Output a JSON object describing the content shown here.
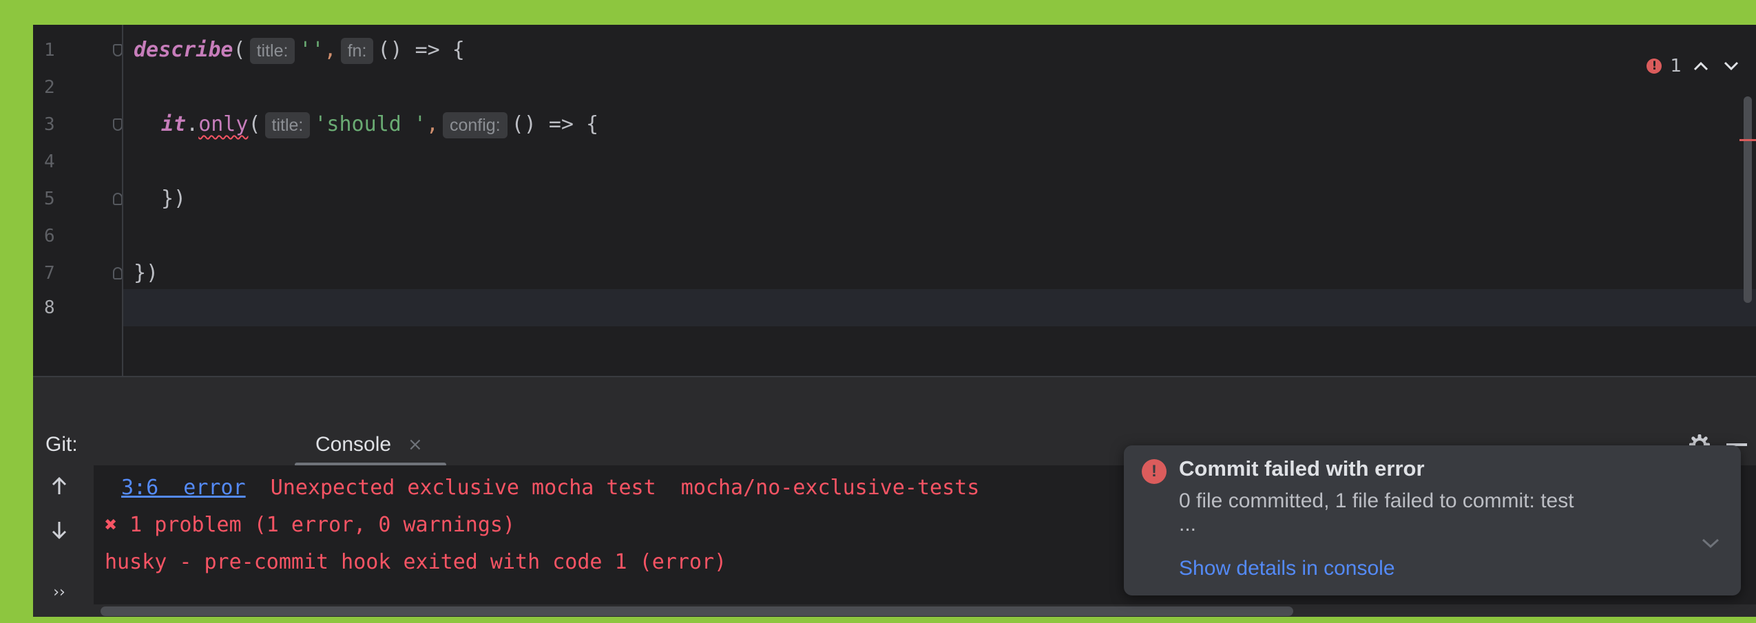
{
  "editor": {
    "line_numbers": [
      "1",
      "2",
      "3",
      "4",
      "5",
      "6",
      "7",
      "8"
    ],
    "line1": {
      "fn": "describe",
      "open": "(",
      "hint_title": "title:",
      "str": "''",
      "comma": ",",
      "hint_fn": "fn:",
      "rest": "() => {"
    },
    "line3": {
      "obj": "it",
      "dot": ".",
      "method": "only",
      "open": "(",
      "hint_title": "title:",
      "str": "'should '",
      "comma": ",",
      "hint_config": "config:",
      "rest": "() => {"
    },
    "line5": "})",
    "line7": "})",
    "error_count": "1"
  },
  "tool_window": {
    "title": "Git:",
    "tab_label": "Console",
    "tab_close": "×",
    "console": {
      "line1_location": "3:6  error",
      "line1_message": "  Unexpected exclusive mocha test  mocha/no-exclusive-tests",
      "line2": "✖ 1 problem (1 error, 0 warnings)",
      "line3": "husky - pre-commit hook exited with code 1 (error)"
    }
  },
  "notification": {
    "title": "Commit failed with error",
    "body": "0 file committed, 1 file failed to commit: test",
    "ellipsis": "...",
    "action": "Show details in console"
  },
  "colors": {
    "accent_link": "#548af7",
    "error": "#f75464",
    "outer_border": "#8dc63f"
  },
  "icons": [
    "error-icon",
    "chevron-up-icon",
    "chevron-down-icon",
    "gear-icon",
    "minimize-icon",
    "arrow-up-icon",
    "arrow-down-icon",
    "more-icon",
    "expand-icon"
  ]
}
